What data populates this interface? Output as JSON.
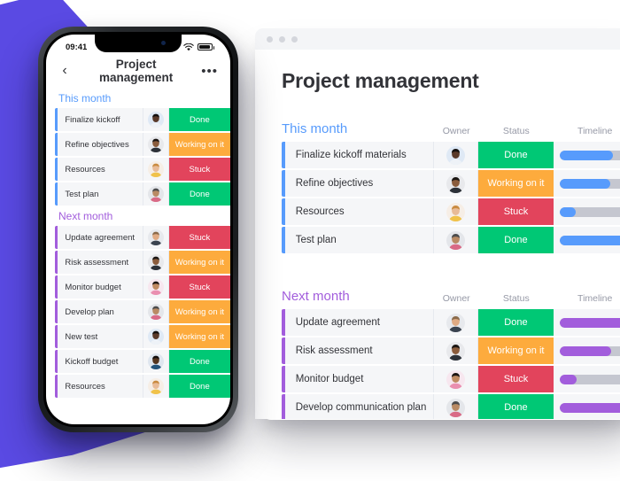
{
  "colors": {
    "done": "#00C875",
    "working": "#FDAB3D",
    "stuck": "#E2445C",
    "blue": "#579BFC",
    "purple": "#A25DDC",
    "blob": "#5A4AE3",
    "track": "#C5C7D0"
  },
  "desktop": {
    "window_dots": [
      "dot",
      "dot",
      "dot"
    ],
    "title": "Project management",
    "columns": {
      "owner": "Owner",
      "status": "Status",
      "timeline": "Timeline"
    },
    "groups": [
      {
        "name": "This month",
        "accent": "blue",
        "rows": [
          {
            "task": "Finalize kickoff materials",
            "status": "Done",
            "status_color": "#00C875",
            "timeline_pct": 76,
            "avatar": "avatar-woman-dark"
          },
          {
            "task": "Refine objectives",
            "status": "Working on it",
            "status_color": "#FDAB3D",
            "timeline_pct": 72,
            "avatar": "avatar-man-beard"
          },
          {
            "task": "Resources",
            "status": "Stuck",
            "status_color": "#E2445C",
            "timeline_pct": 23,
            "avatar": "avatar-woman-blonde"
          },
          {
            "task": "Test plan",
            "status": "Done",
            "status_color": "#00C875",
            "timeline_pct": 100,
            "avatar": "avatar-man-gray"
          }
        ]
      },
      {
        "name": "Next month",
        "accent": "purple",
        "rows": [
          {
            "task": "Update agreement",
            "status": "Done",
            "status_color": "#00C875",
            "timeline_pct": 100,
            "avatar": "avatar-man-blond"
          },
          {
            "task": "Risk assessment",
            "status": "Working on it",
            "status_color": "#FDAB3D",
            "timeline_pct": 74,
            "avatar": "avatar-man-beard"
          },
          {
            "task": "Monitor budget",
            "status": "Stuck",
            "status_color": "#E2445C",
            "timeline_pct": 24,
            "avatar": "avatar-woman-brunette"
          },
          {
            "task": "Develop communication plan",
            "status": "Done",
            "status_color": "#00C875",
            "timeline_pct": 100,
            "avatar": "avatar-man-gray"
          }
        ]
      }
    ]
  },
  "phone": {
    "status_bar": {
      "time": "09:41",
      "wifi": "wifi-icon",
      "battery": "battery-icon"
    },
    "header": {
      "back": "‹",
      "title": "Project management",
      "menu": "•••"
    },
    "groups": [
      {
        "name": "This month",
        "accent": "blue",
        "rows": [
          {
            "task": "Finalize kickoff",
            "status": "Done",
            "status_color": "#00C875",
            "avatar": "avatar-woman-dark"
          },
          {
            "task": "Refine objectives",
            "status": "Working on it",
            "status_color": "#FDAB3D",
            "avatar": "avatar-man-beard"
          },
          {
            "task": "Resources",
            "status": "Stuck",
            "status_color": "#E2445C",
            "avatar": "avatar-woman-blonde"
          },
          {
            "task": "Test plan",
            "status": "Done",
            "status_color": "#00C875",
            "avatar": "avatar-man-gray"
          }
        ]
      },
      {
        "name": "Next month",
        "accent": "purple",
        "rows": [
          {
            "task": "Update agreement",
            "status": "Stuck",
            "status_color": "#E2445C",
            "avatar": "avatar-man-blond"
          },
          {
            "task": "Risk assessment",
            "status": "Working on it",
            "status_color": "#FDAB3D",
            "avatar": "avatar-man-beard"
          },
          {
            "task": "Monitor budget",
            "status": "Stuck",
            "status_color": "#E2445C",
            "avatar": "avatar-woman-brunette"
          },
          {
            "task": "Develop plan",
            "status": "Working on it",
            "status_color": "#FDAB3D",
            "avatar": "avatar-man-gray"
          },
          {
            "task": "New test",
            "status": "Working on it",
            "status_color": "#FDAB3D",
            "avatar": "avatar-woman-dark"
          },
          {
            "task": "Kickoff budget",
            "status": "Done",
            "status_color": "#00C875",
            "avatar": "avatar-man-dark"
          },
          {
            "task": "Resources",
            "status": "Done",
            "status_color": "#00C875",
            "avatar": "avatar-woman-blonde"
          }
        ]
      }
    ]
  }
}
